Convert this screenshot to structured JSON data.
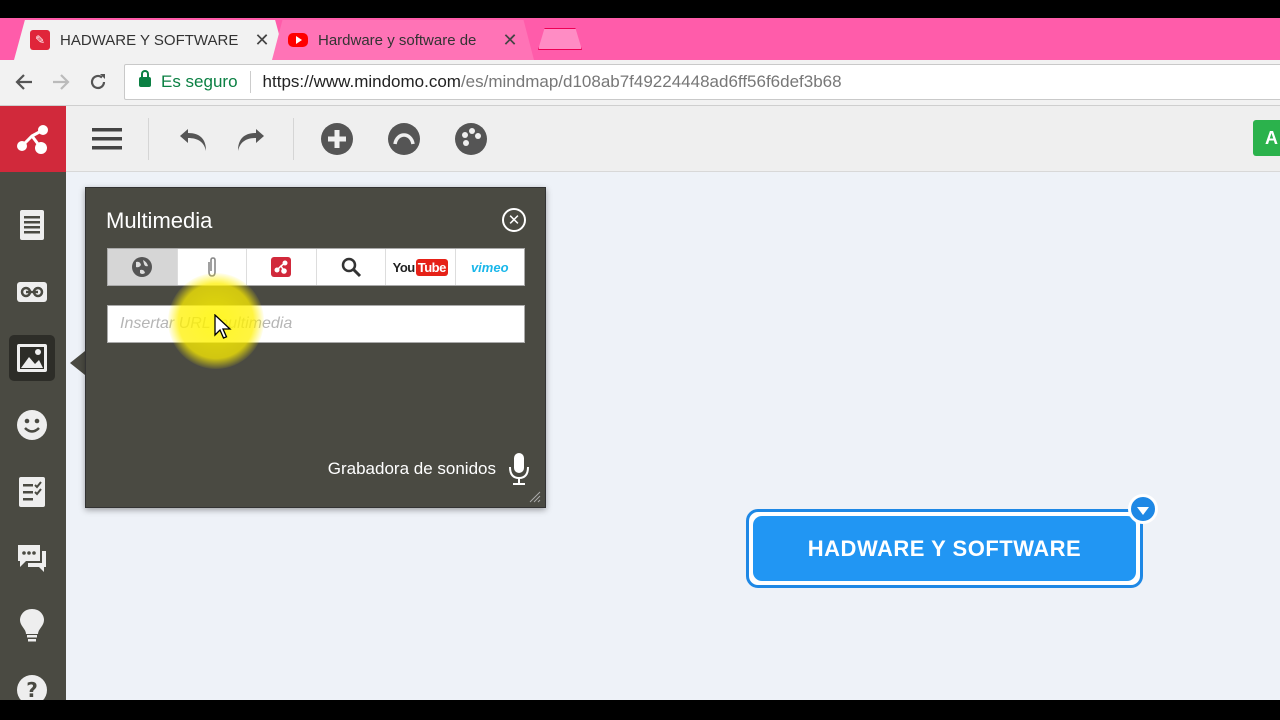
{
  "browser": {
    "tabs": [
      {
        "title": "HADWARE Y SOFTWARE",
        "icon": "mindomo-favicon-icon",
        "active": true
      },
      {
        "title": "Hardware y software de",
        "icon": "youtube-favicon-icon",
        "active": false
      }
    ],
    "address": {
      "secure_label": "Es seguro",
      "url_host": "https://www.mindomo.com",
      "url_path": "/es/mindmap/d108ab7f49224448ad6ff56f6def3b68"
    },
    "colors": {
      "tabstrip": "#ff5caa",
      "secure": "#0b8043"
    }
  },
  "app": {
    "toolbar": {
      "menu": "hamburger-icon",
      "undo": "undo-icon",
      "redo": "redo-icon",
      "add": "add-topic-icon",
      "relationship": "relationship-icon",
      "theme": "palette-icon",
      "right_button_label": "A"
    },
    "sidebar": [
      "notes-icon",
      "link-icon",
      "image-icon",
      "smiley-icon",
      "task-icon",
      "comments-icon",
      "idea-icon",
      "help-icon"
    ],
    "panel": {
      "title": "Multimedia",
      "source_tabs": [
        "web-icon",
        "attachment-icon",
        "mindomo-icon",
        "search-icon",
        "YouTube",
        "vimeo"
      ],
      "youtube_label": {
        "you": "You",
        "tube": "Tube"
      },
      "vimeo_label": "vimeo",
      "input_placeholder": "Insertar URL multimedia",
      "recorder_label": "Grabadora de sonidos"
    },
    "central_node": {
      "label": "HADWARE Y SOFTWARE",
      "color": "#2196f3"
    }
  }
}
